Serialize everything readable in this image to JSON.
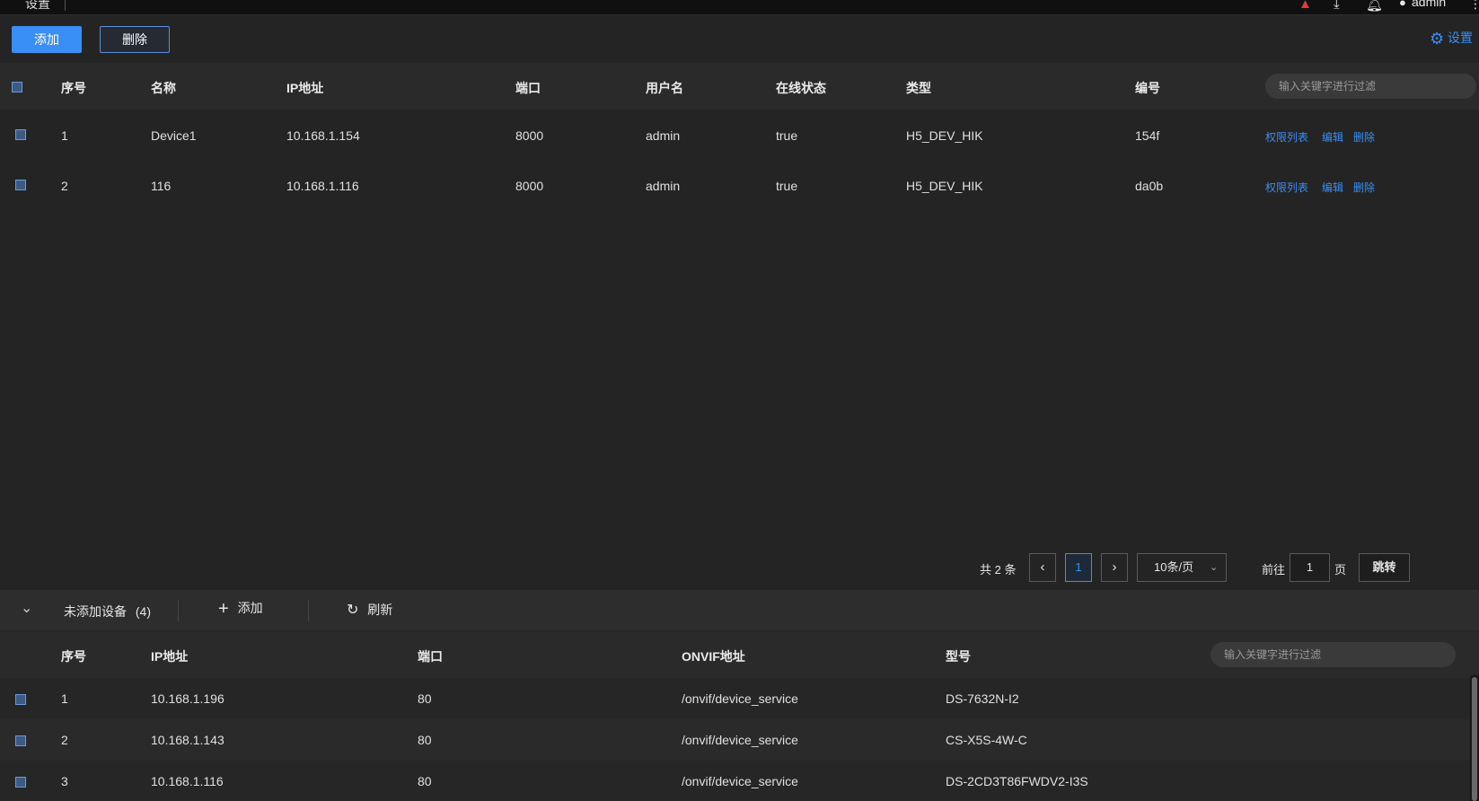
{
  "topbar": {
    "title": "设置",
    "user": "admin",
    "icons": [
      "warning-icon",
      "download-icon",
      "bell-icon",
      "user-icon",
      "more-icon"
    ]
  },
  "toolbar": {
    "add_label": "添加",
    "delete_label": "删除",
    "settings_label": "设置"
  },
  "device_table": {
    "headers": [
      "序号",
      "名称",
      "IP地址",
      "端口",
      "用户名",
      "在线状态",
      "类型",
      "编号"
    ],
    "search_placeholder": "输入关键字进行过滤",
    "rows": [
      {
        "index": "1",
        "name": "Device1",
        "ip": "10.168.1.154",
        "port": "8000",
        "user": "admin",
        "online": "true",
        "type": "H5_DEV_HIK",
        "code": "154f"
      },
      {
        "index": "2",
        "name": "116",
        "ip": "10.168.1.116",
        "port": "8000",
        "user": "admin",
        "online": "true",
        "type": "H5_DEV_HIK",
        "code": "da0b"
      }
    ],
    "actions": {
      "permissions": "权限列表",
      "edit": "编辑",
      "delete": "删除"
    }
  },
  "pagination": {
    "total": "共 2 条",
    "current_page": "1",
    "page_size": "10条/页",
    "goto_prefix": "前往",
    "goto_value": "1",
    "goto_suffix": "页",
    "jump_label": "跳转"
  },
  "unadded_section": {
    "title": "未添加设备",
    "count": "(4)",
    "add_label": "添加",
    "refresh_label": "刷新",
    "headers": [
      "序号",
      "IP地址",
      "端口",
      "ONVIF地址",
      "型号"
    ],
    "search_placeholder": "输入关键字进行过滤",
    "rows": [
      {
        "index": "1",
        "ip": "10.168.1.196",
        "port": "80",
        "onvif": "/onvif/device_service",
        "model": "DS-7632N-I2"
      },
      {
        "index": "2",
        "ip": "10.168.1.143",
        "port": "80",
        "onvif": "/onvif/device_service",
        "model": "CS-X5S-4W-C"
      },
      {
        "index": "3",
        "ip": "10.168.1.116",
        "port": "80",
        "onvif": "/onvif/device_service",
        "model": "DS-2CD3T86FWDV2-I3S"
      }
    ]
  },
  "colors": {
    "accent": "#3a8ef6",
    "background": "#242424",
    "warning": "#e03a3a"
  }
}
